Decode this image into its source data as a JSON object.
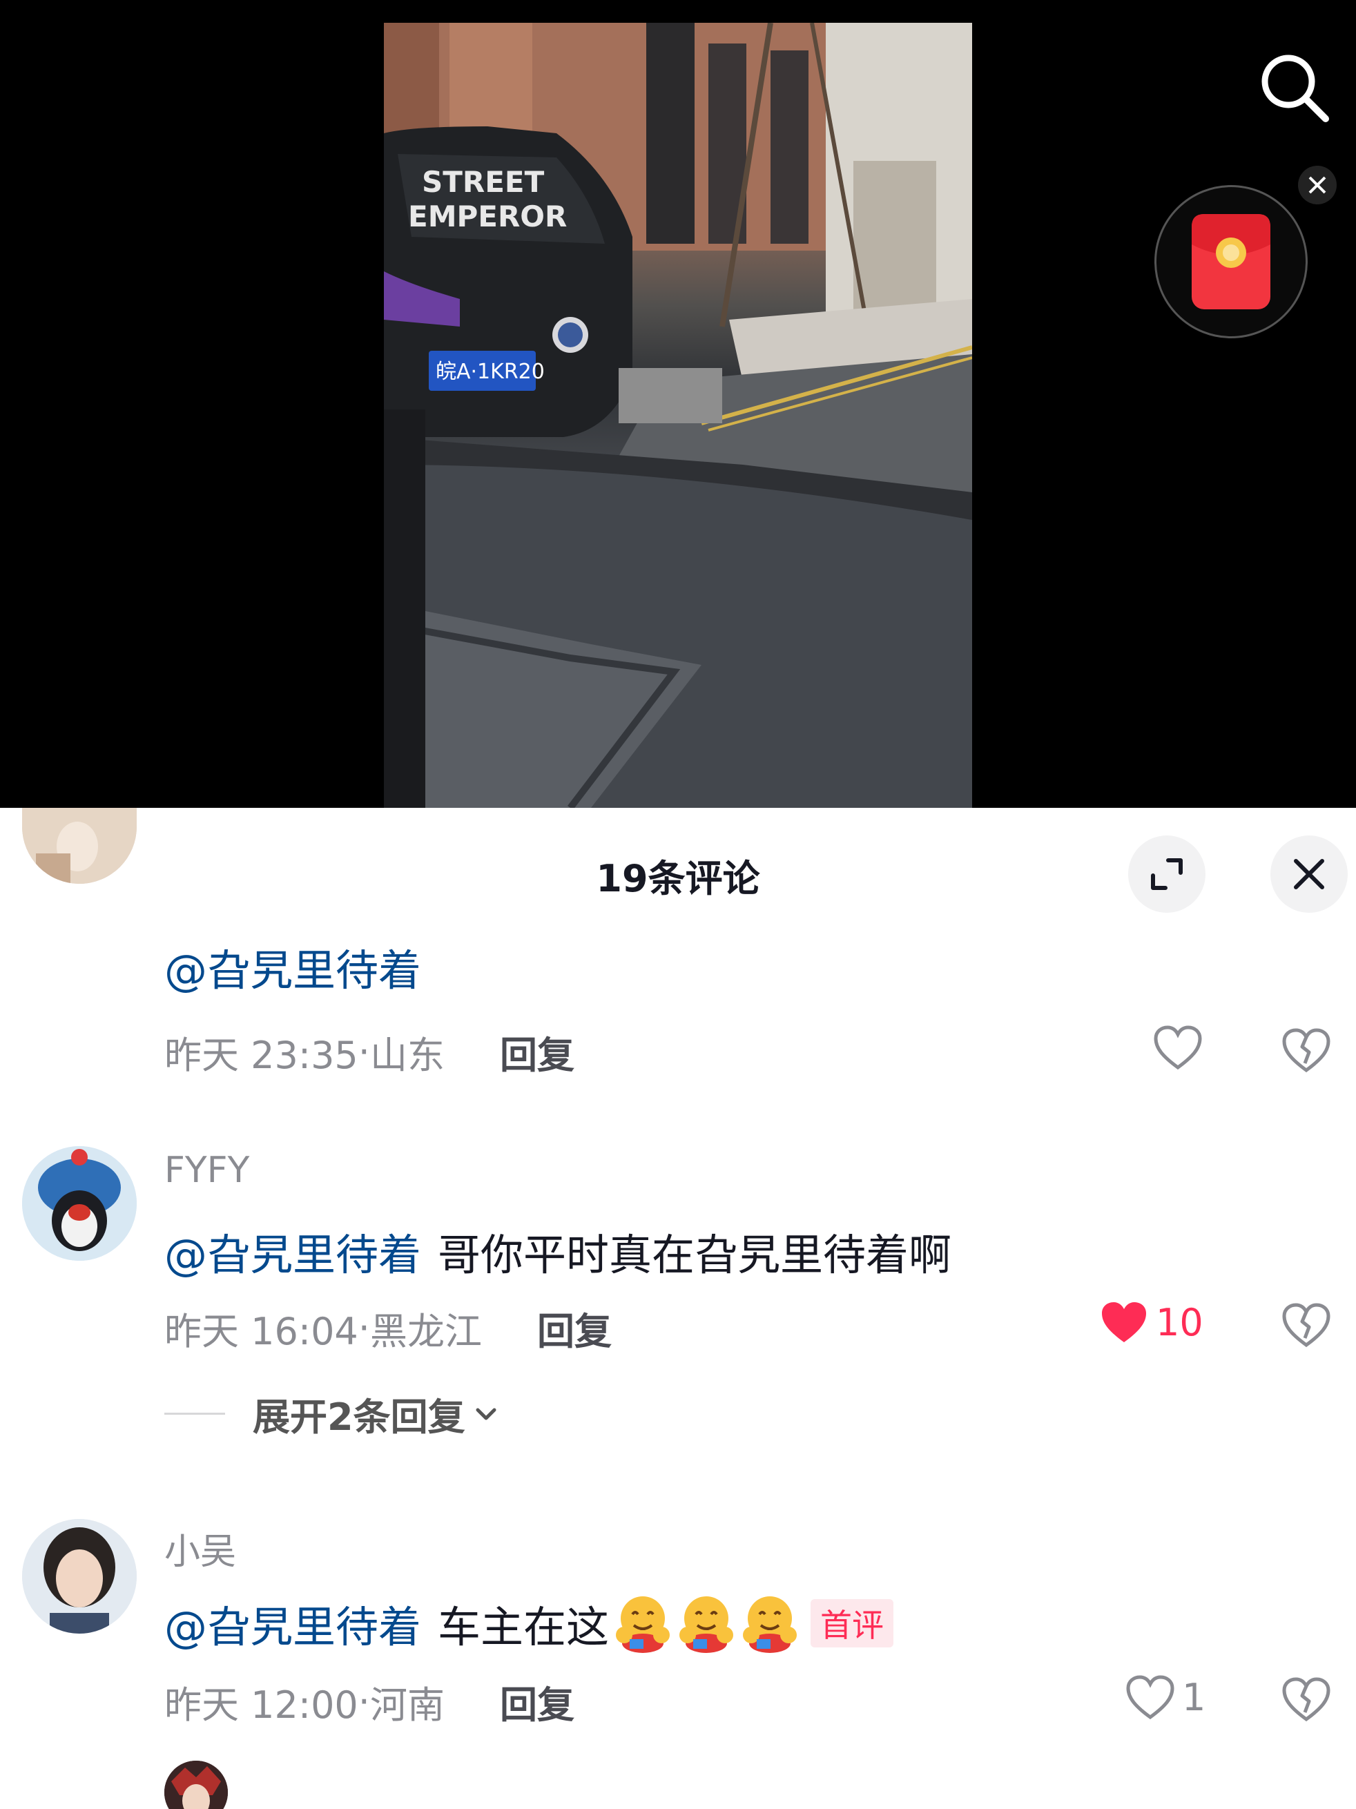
{
  "video": {
    "windshield_text_line1": "STREET",
    "windshield_text_line2": "EMPEROR",
    "plate_text": "皖A·1KR20"
  },
  "panel": {
    "title": "19条评论"
  },
  "comments": [
    {
      "username": "",
      "mention": "@旮旯里待着",
      "body": "",
      "time": "昨天 23:35",
      "location": "山东",
      "reply_label": "回复",
      "likes": ""
    },
    {
      "username": "FYFY",
      "mention": "@旮旯里待着",
      "body": "哥你平时真在旮旯里待着啊",
      "time": "昨天 16:04",
      "location": "黑龙江",
      "reply_label": "回复",
      "likes": "10",
      "expand_label": "展开2条回复"
    },
    {
      "username": "小吴",
      "mention": "@旮旯里待着",
      "body": "车主在这",
      "badge": "首评",
      "time": "昨天 12:00",
      "location": "河南",
      "reply_label": "回复",
      "likes": "1"
    }
  ],
  "colors": {
    "like_active": "#fe2c55",
    "mention": "#04498d",
    "meta": "#8a8b91"
  }
}
